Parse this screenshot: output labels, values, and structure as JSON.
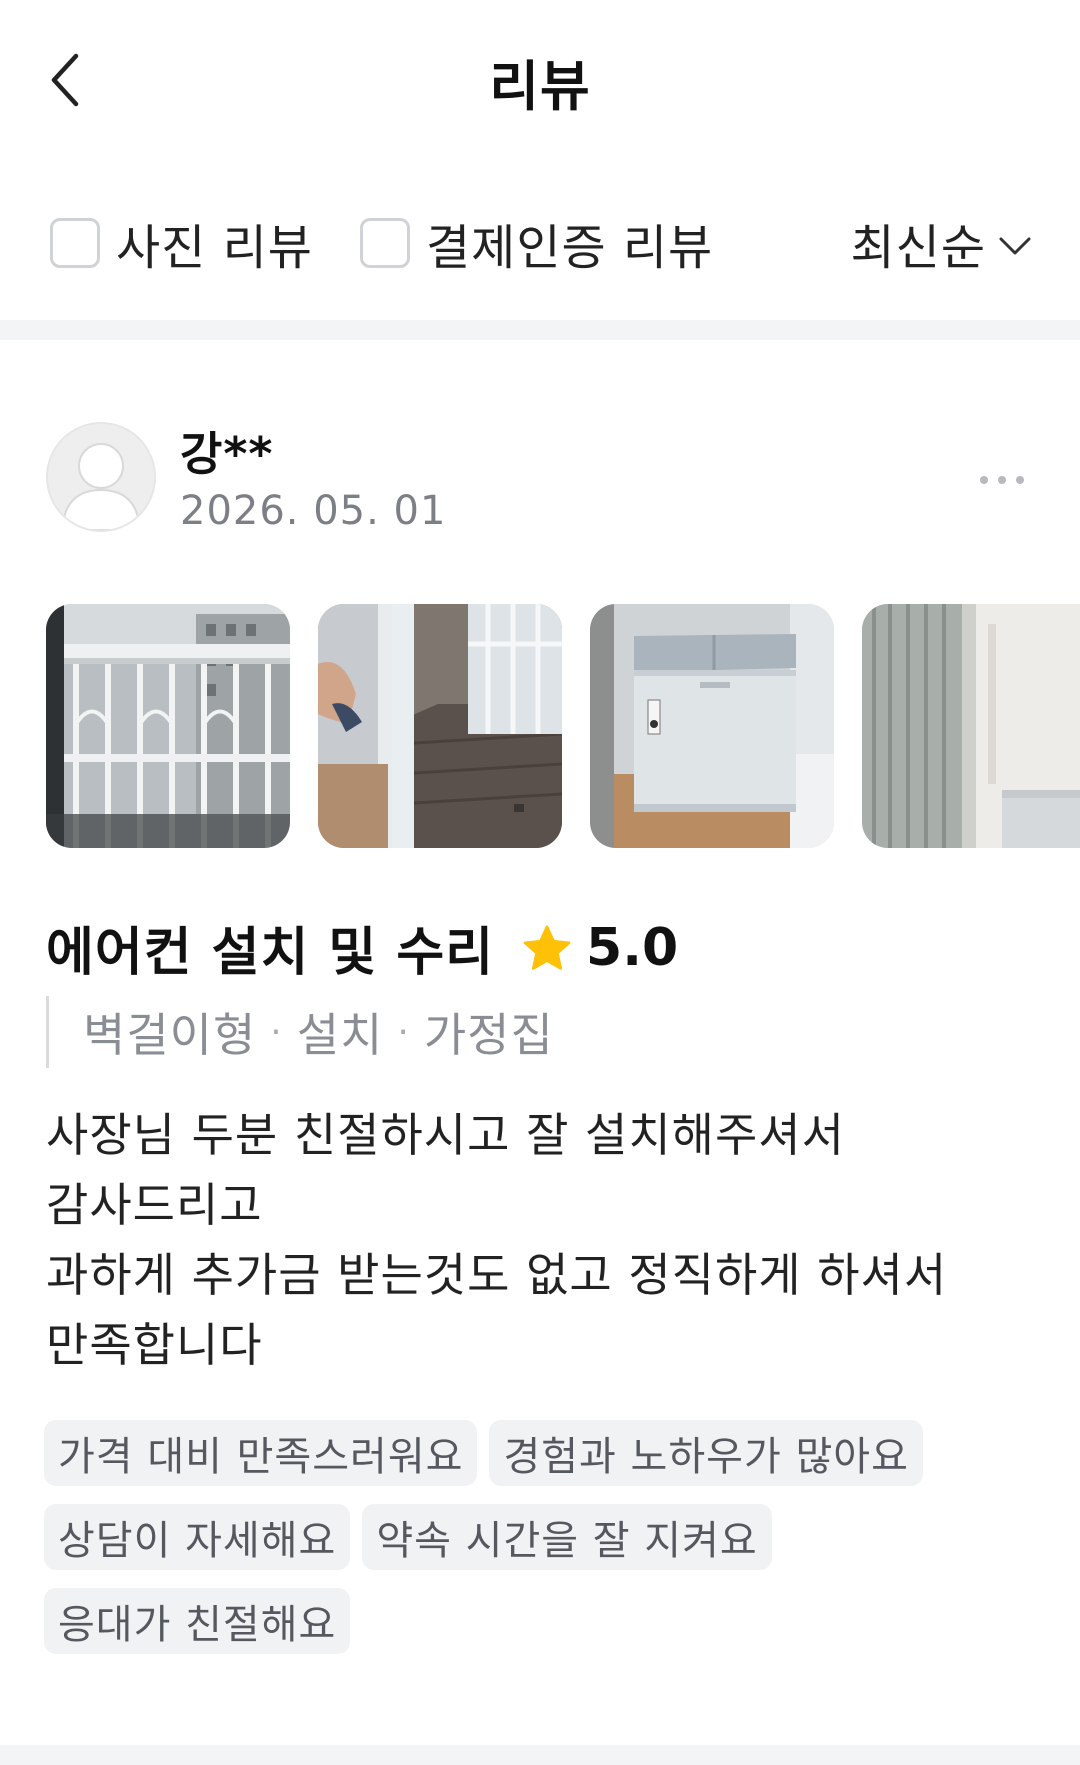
{
  "header": {
    "title": "리뷰",
    "back_icon": "chevron-left-icon"
  },
  "filters": {
    "photo_review": {
      "label": "사진 리뷰",
      "checked": false
    },
    "payment_verified_review": {
      "label": "결제인증 리뷰",
      "checked": false
    },
    "sort": {
      "selected": "최신순",
      "icon": "chevron-down-icon"
    }
  },
  "review": {
    "author": "강**",
    "date": "2026. 05. 01",
    "more_icon": "more-horizontal-icon",
    "photos": [
      "balcony-railing-photo",
      "freezer-moving-photo",
      "chest-freezer-photo",
      "curtain-room-photo"
    ],
    "service_title": "에어컨 설치 및 수리",
    "rating": "5.0",
    "rating_icon": "star-icon",
    "rating_color": "#FFC107",
    "meta": [
      "벽걸이형",
      "설치",
      "가정집"
    ],
    "text_lines": [
      "사장님 두분 친절하시고 잘 설치해주셔서",
      "감사드리고",
      "과하게 추가금 받는것도 없고 정직하게 하셔서",
      "만족합니다"
    ],
    "tags": [
      "가격 대비 만족스러워요",
      "경험과 노하우가 많아요",
      "상담이 자세해요",
      "약속 시간을 잘 지켜요",
      "응대가 친절해요"
    ]
  }
}
